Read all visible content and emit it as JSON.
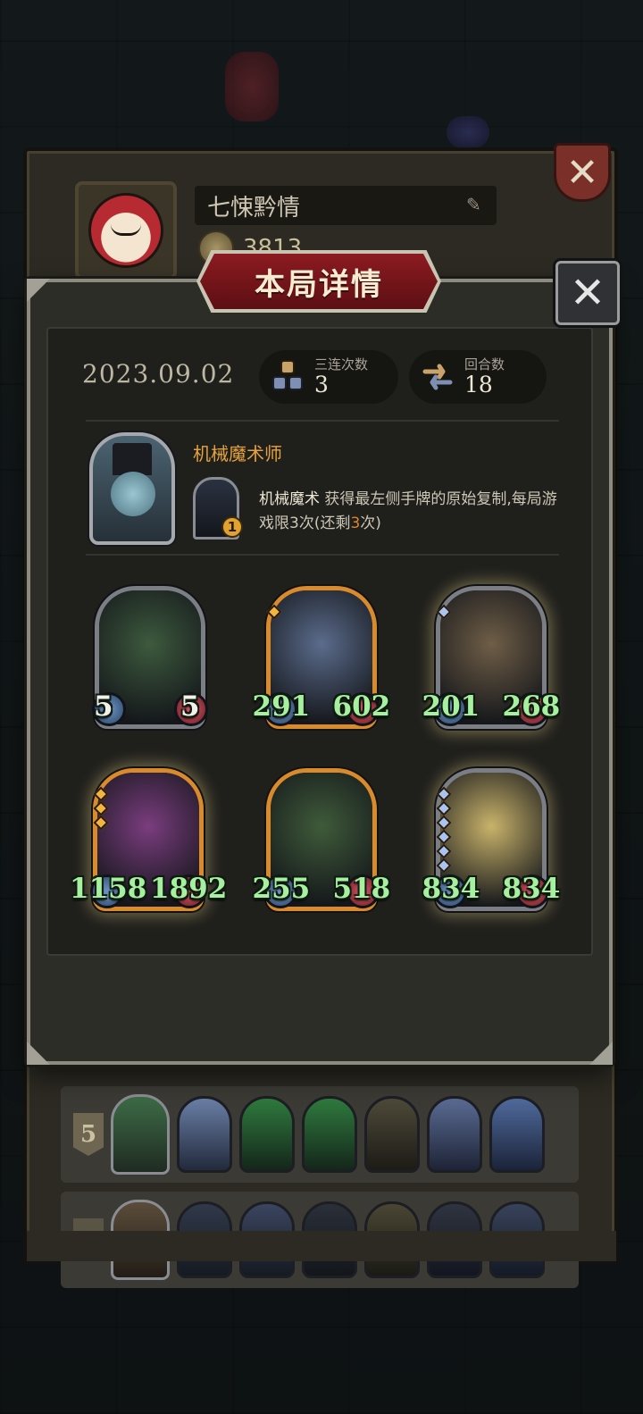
{
  "background": {
    "player_name": "七悚黔情",
    "coins": "3813",
    "history": [
      {
        "rank": "5"
      }
    ]
  },
  "modal": {
    "title": "本局详情",
    "date": "2023.09.02",
    "triples": {
      "label": "三连次数",
      "value": "3"
    },
    "rounds": {
      "label": "回合数",
      "value": "18"
    },
    "hero": {
      "name": "机械魔术师",
      "skill_level": "1",
      "skill_name": "机械魔术",
      "skill_desc": " 获得最左侧手牌的原始复制,每局游戏限3次(还剩",
      "skill_remaining": "3",
      "skill_end": "次)"
    },
    "cards": [
      {
        "atk": "5",
        "hp": "5",
        "frame": "silver",
        "bg": "#3d5a3e",
        "stars": 0,
        "white": true
      },
      {
        "atk": "291",
        "hp": "602",
        "frame": "gold",
        "bg": "#5b6c8c",
        "stars": 1,
        "white": false
      },
      {
        "atk": "201",
        "hp": "268",
        "frame": "silver-glow",
        "bg": "#6f5e47",
        "stars": 1,
        "white": false
      },
      {
        "atk": "1158",
        "hp": "1892",
        "frame": "gold-glow",
        "bg": "#7a3d7f",
        "stars": 3,
        "white": false
      },
      {
        "atk": "255",
        "hp": "518",
        "frame": "gold",
        "bg": "#3f5b3a",
        "stars": 0,
        "white": false
      },
      {
        "atk": "834",
        "hp": "834",
        "frame": "silver-glow",
        "bg": "#c9b36b",
        "stars": 6,
        "white": false
      }
    ]
  },
  "colors": {
    "accent_orange": "#e7a33b",
    "stat_green": "#a6f0a0",
    "banner_red": "#8c1b21"
  },
  "icons": {
    "close": "close-icon",
    "edit": "pencil-icon",
    "triples": "triple-stack-icon",
    "rounds": "cycle-arrows-icon"
  }
}
